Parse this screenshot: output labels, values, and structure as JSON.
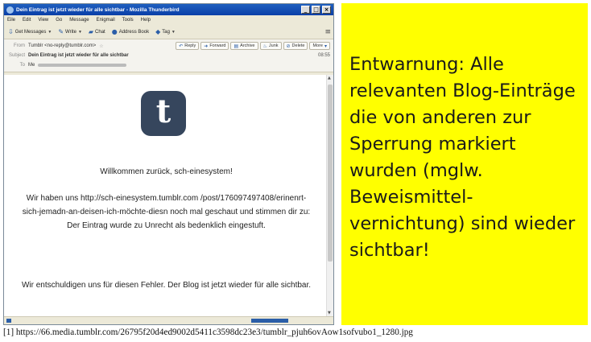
{
  "window": {
    "title": "Dein Eintrag ist jetzt wieder für alle sichtbar - Mozilla Thunderbird",
    "controls": [
      "_",
      "□",
      "×"
    ]
  },
  "menu": [
    "Eile",
    "Edit",
    "View",
    "Go",
    "Message",
    "Enigmail",
    "Tools",
    "Help"
  ],
  "toolbar": {
    "get_messages": "Get Messages",
    "write": "Write",
    "chat": "Chat",
    "address_book": "Address Book",
    "tag": "Tag"
  },
  "header": {
    "from_label": "From",
    "from_value": "Tumblr <no-reply@tumblr.com>",
    "actions": [
      "Reply",
      "Forward",
      "Archive",
      "Junk",
      "Delete",
      "More"
    ],
    "subject_label": "Subject",
    "subject_value": "Dein Eintrag ist jetzt wieder für alle sichtbar",
    "time": "08:55",
    "to_label": "To",
    "to_value": "Me"
  },
  "message": {
    "welcome": "Willkommen zurück, sch-einesystem!",
    "paragraph1": "Wir haben uns http://sch-einesystem.tumblr.com /post/176097497408/erinenrt-sich-jemadn-an-deisen-ich-möchte-diesn noch mal geschaut und stimmen dir zu: Der Eintrag wurde zu Unrecht als bedenklich eingestuft.",
    "paragraph2": "Wir entschuldigen uns für diesen Fehler. Der Blog ist jetzt wieder für alle sichtbar."
  },
  "panel": {
    "text": "Entwarnung: Alle relevanten Blog-Einträge die von anderen zur Sperrung markiert wurden (mglw. Beweismittel-vernichtung) sind wieder sichtbar!"
  },
  "caption": "[1] https://66.media.tumblr.com/26795f20d4ed9002d5411c3598dc23e3/tumblr_pjuh6ovAow1sofvubo1_1280.jpg",
  "colors": {
    "panel_background": "#ffff00",
    "tumblr_logo": "#36465d",
    "titlebar": "#0a3fa8"
  },
  "icons": [
    "thunderbird-icon",
    "get-messages-icon",
    "write-icon",
    "chat-icon",
    "address-book-icon",
    "tag-icon",
    "menu-icon",
    "star-icon",
    "reply-icon",
    "forward-icon",
    "archive-icon",
    "junk-icon",
    "delete-icon",
    "tumblr-logo"
  ]
}
